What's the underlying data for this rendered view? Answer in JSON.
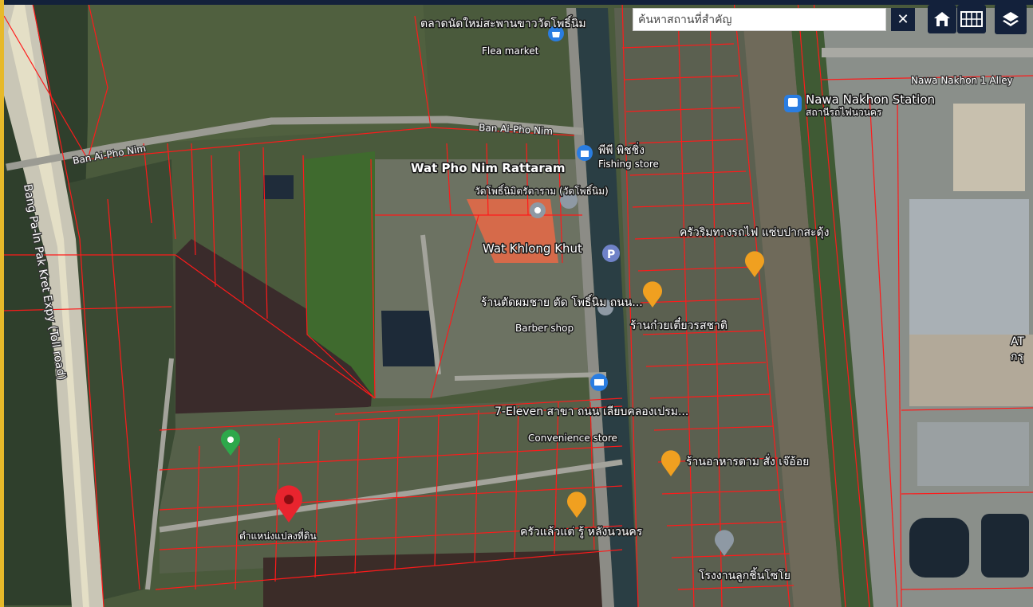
{
  "search": {
    "placeholder": "ค้นหาสถานที่สำคัญ",
    "clear_icon": "close-icon"
  },
  "controls": [
    {
      "name": "home-button",
      "icon": "home-icon"
    },
    {
      "name": "grid-button",
      "icon": "grid-icon"
    },
    {
      "name": "layers-button",
      "icon": "layers-icon"
    }
  ],
  "roads": {
    "ban_ai_pho_nim_east": "Ban Ai-Pho Nim",
    "ban_ai_pho_nim_west": "Ban Ai-Pho Nim",
    "expressway": "Bang Pa-In Pak Kret Expy (Toll road)",
    "nawa_nakhon_alley": "Nawa Nakhon 1 Alley"
  },
  "places": {
    "flea_market_th": "ตลาดนัดใหม่สะพานขาววัดโพธิ์นิม",
    "flea_market_en": "Flea market",
    "wat_pho_nim": "Wat Pho Nim Rattaram",
    "wat_pho_nim_th": "วัดโพธิ์นิมิตรัตาราม (วัดโพธิ์นิม)",
    "fishing_th": "พีพี พิชชิ่ง",
    "fishing_en": "Fishing store",
    "nawa_station": "Nawa Nakhon Station",
    "nawa_station_th": "สถานีรถไฟนวนคร",
    "wat_khlong_khut": "Wat Khlong Khut",
    "restaurant_1": "ครัวริมทางรถไฟ แซ่บปากสะดุ้ง",
    "barber_th": "ร้านตัดผมชาย ตัด โพธิ์นิม ถนน...",
    "barber_en": "Barber shop",
    "noodle_th": "ร้านก๋วยเตี๋ยวรสชาติ",
    "seven_th": "7-Eleven สาขา ถนน เลียบคลองเปรม...",
    "seven_en": "Convenience store",
    "restaurant_2": "ร้านอาหารตาม สั่ง เจ๊อ้อย",
    "restaurant_3": "ครัวแล้วแต่ รู้ หลังนวนคร",
    "factory": "โรงงานลูกชิ้นโซโย",
    "plot": "ตำแหน่งแปลงที่ดิน",
    "edge_at": "AT",
    "edge_th": "กรุ"
  },
  "colors": {
    "topbar": "#13213b",
    "accent": "#e6b92a",
    "parcel": "#ff1a1a",
    "pin_red": "#e8242e",
    "pin_green": "#2ea84b",
    "poi_blue": "#2a7de1",
    "poi_orange": "#f0a020",
    "poi_gray": "#8e99a4"
  }
}
